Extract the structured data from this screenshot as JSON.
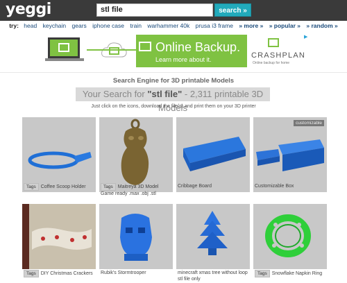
{
  "header": {
    "logo": "yeggi",
    "search_value": "stl file",
    "search_button": "search »"
  },
  "try": {
    "label": "try:",
    "items": [
      "head",
      "keychain",
      "gears",
      "iphone case",
      "train",
      "warhammer 40k",
      "prusa i3 frame"
    ],
    "more": "» more »",
    "popular": "» popular »",
    "random": "» random »"
  },
  "ad": {
    "headline": "Online Backup.",
    "cta": "Learn more about it.",
    "brand": "CRASHPLAN",
    "brand_tagline": "Online backup for home"
  },
  "page": {
    "heading": "Search Engine for 3D printable Models",
    "results_prefix": "Your Search for ",
    "results_query": "\"stl file\"",
    "results_suffix": " - 2,311 printable 3D Models",
    "instructions": "Just click on the icons, download the file(s) and print them on your 3D printer"
  },
  "models": [
    {
      "tag": "Tags",
      "title": "Coffee Scoop Holder",
      "badge": ""
    },
    {
      "tag": "Tags",
      "title": "Maitreya 3D Model Game ready .max .obj .stl",
      "badge": ""
    },
    {
      "tag": "",
      "title": "Cribbage Board",
      "badge": ""
    },
    {
      "tag": "",
      "title": "Customizable Box",
      "badge": "customizable"
    },
    {
      "tag": "Tags",
      "title": "DIY Christmas Crackers",
      "badge": ""
    },
    {
      "tag": "",
      "title": "Rubik's Stormtrooper",
      "badge": ""
    },
    {
      "tag": "",
      "title": "minecraft xmas tree without loop stl file only",
      "badge": ""
    },
    {
      "tag": "Tags",
      "title": "Snowflake Napkin Ring",
      "badge": ""
    }
  ],
  "colors": {
    "accent": "#22aabb",
    "ad_green": "#7fc242",
    "model_blue": "#1f6fd6"
  }
}
